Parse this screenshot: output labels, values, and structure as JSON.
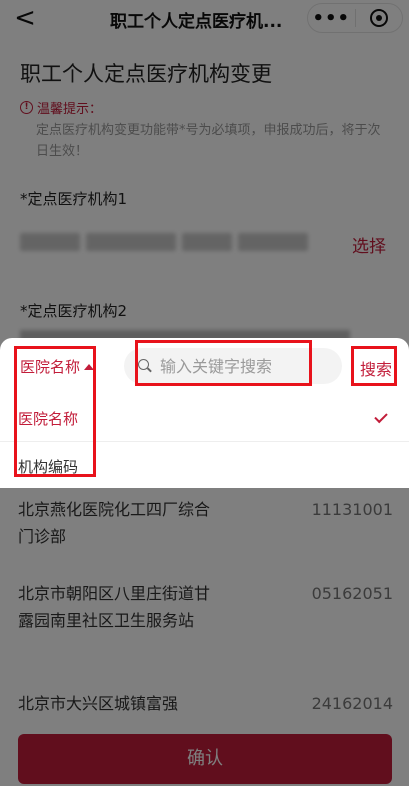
{
  "navbar": {
    "back_symbol": "<",
    "title": "职工个人定点医疗机...",
    "more_symbol": "•••",
    "icons": {
      "back": "chevron-left-icon",
      "more": "more-dots-icon",
      "close": "target-circle-icon"
    }
  },
  "page": {
    "title": "职工个人定点医疗机构变更",
    "tip_icon": "!",
    "tip_heading": "温馨提示：",
    "tip_body": "定点医疗机构变更功能带*号为必填项，申报成功后，将于次日生效！",
    "field1_label": "定点医疗机构1",
    "field2_label": "定点医疗机构2",
    "required_mark": "*",
    "choose_label": "选择"
  },
  "list": {
    "items": [
      {
        "name": "北京燕化医院化工四厂综合门诊部",
        "code": "11131001"
      },
      {
        "name": "北京市朝阳区八里庄街道甘露园南里社区卫生服务站",
        "code": "05162051"
      },
      {
        "name": "北京市大兴区城镇富强",
        "code": "24162014"
      }
    ]
  },
  "confirm_label": "确认",
  "sheet": {
    "filter_selected": "医院名称",
    "search_placeholder": "输入关键字搜索",
    "search_value": "",
    "search_button": "搜索",
    "options": [
      {
        "label": "医院名称",
        "selected": true
      },
      {
        "label": "机构编码",
        "selected": false
      }
    ]
  },
  "colors": {
    "accent": "#c21d3a",
    "highlight_box": "#e8121b",
    "mask": "rgba(0,0,0,0.5)"
  }
}
